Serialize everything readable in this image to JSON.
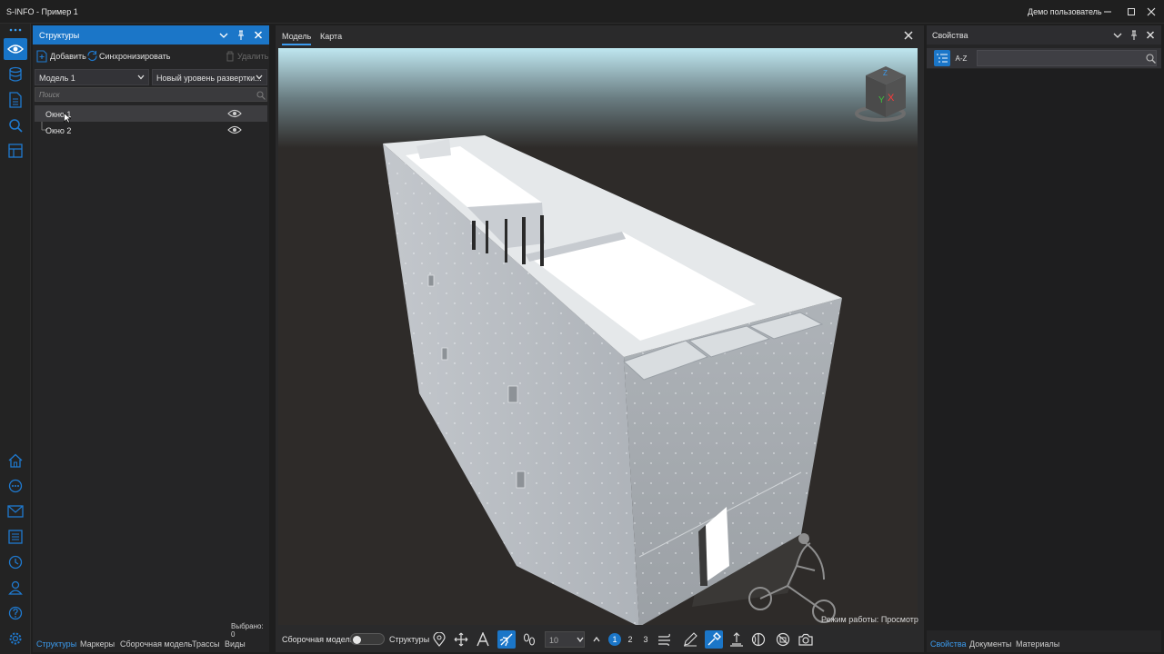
{
  "app": {
    "title": "S-INFO - Пример 1",
    "user": "Демо пользователь"
  },
  "structures_panel": {
    "title": "Структуры",
    "toolbar": {
      "add": "Добавить",
      "sync": "Синхронизировать",
      "delete": "Удалить"
    },
    "model_select": "Модель 1",
    "level_select": "Новый уровень развертки...",
    "search_placeholder": "Поиск",
    "items": [
      {
        "label": "Окно 1",
        "selected": true
      },
      {
        "label": "Окно 2",
        "selected": false
      }
    ],
    "selected_count": "Выбрано: 0",
    "bottom_tabs": [
      "Структуры",
      "Маркеры",
      "Сборочная модель",
      "Трассы",
      "Виды"
    ]
  },
  "center": {
    "tabs": [
      "Модель",
      "Карта"
    ],
    "mode_status": "Режим работы: Просмотр",
    "bottom": {
      "assembly_label": "Сборочная модель",
      "assembly_toggle": false,
      "structures_label": "Структуры",
      "zoom_value": "10",
      "levels": [
        "1",
        "2",
        "3"
      ],
      "active_level": "1"
    },
    "navcube": {
      "labels": [
        "X",
        "Y",
        "Z"
      ]
    }
  },
  "properties_panel": {
    "title": "Свойства",
    "az_label": "A-Z",
    "bottom_tabs": [
      "Свойства",
      "Документы",
      "Материалы"
    ]
  },
  "colors": {
    "accent": "#1b76c8",
    "link_active": "#3b9cf0",
    "panel": "#252526",
    "ground": "#2e2b29"
  }
}
